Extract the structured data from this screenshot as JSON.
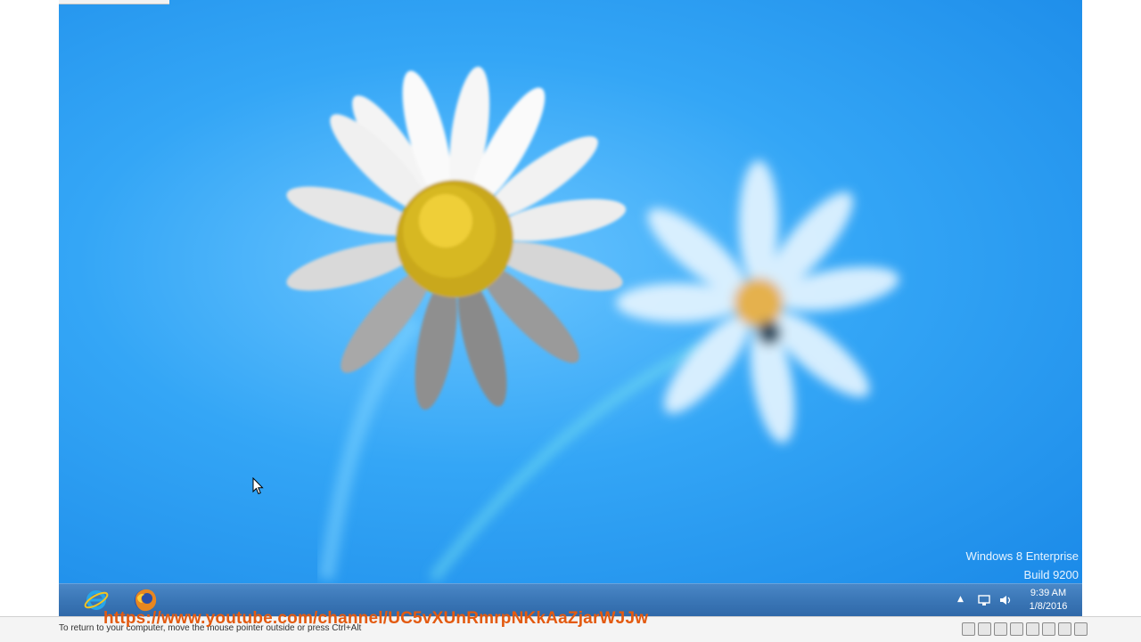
{
  "desktop": {
    "watermark": {
      "line1": "Windows 8 Enterprise",
      "line2": "Build 9200"
    }
  },
  "taskbar": {
    "apps": [
      {
        "name": "Internet Explorer",
        "icon": "internet-explorer-icon"
      },
      {
        "name": "Firefox",
        "icon": "firefox-icon"
      }
    ],
    "tray": {
      "time": "9:39 AM",
      "date": "1/8/2016",
      "icons": [
        "show-hidden-icons-chevron",
        "network-icon",
        "volume-icon"
      ]
    }
  },
  "vm_status": {
    "hint": "To return to your computer, move the mouse pointer outside or press Ctrl+Alt",
    "overlay_url": "https://www.youtube.com/channel/UC5vXUnRmrpNKkAaZjarWJJw",
    "icons": [
      "hard-disk-icon",
      "cd-icon",
      "network-adapter-icon",
      "usb-icon",
      "printer-icon",
      "audio-icon",
      "display-icon",
      "fullscreen-icon"
    ]
  },
  "colors": {
    "desktop_blue": "#34a6f6",
    "taskbar": "#3a76b6",
    "overlay_url": "#e35a10"
  }
}
